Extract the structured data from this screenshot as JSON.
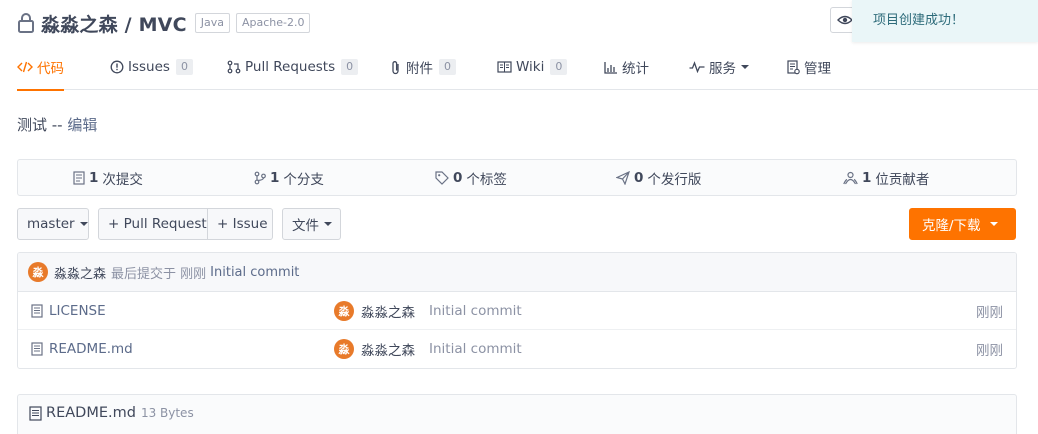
{
  "repo": {
    "title": "淼淼之森 / MVC",
    "tags": [
      "Java",
      "Apache-2.0"
    ]
  },
  "toast": {
    "message": "项目创建成功！"
  },
  "tabs": [
    {
      "label": "代码",
      "icon": "code-icon",
      "active": true
    },
    {
      "label": "Issues",
      "icon": "issue-icon",
      "count": "0"
    },
    {
      "label": "Pull Requests",
      "icon": "pull-request-icon",
      "count": "0"
    },
    {
      "label": "附件",
      "icon": "paperclip-icon",
      "count": "0"
    },
    {
      "label": "Wiki",
      "icon": "wiki-icon",
      "count": "0"
    },
    {
      "label": "统计",
      "icon": "bar-chart-icon"
    },
    {
      "label": "服务",
      "icon": "pulse-icon",
      "dropdown": true
    },
    {
      "label": "管理",
      "icon": "settings-doc-icon"
    }
  ],
  "description": {
    "text": "测试 -- ",
    "edit_link": "编辑"
  },
  "stats": [
    {
      "value": "1",
      "label": "次提交",
      "icon": "commit-icon"
    },
    {
      "value": "1",
      "label": "个分支",
      "icon": "branch-icon"
    },
    {
      "value": "0",
      "label": "个标签",
      "icon": "tag-icon"
    },
    {
      "value": "0",
      "label": "个发行版",
      "icon": "release-icon"
    },
    {
      "value": "1",
      "label": "位贡献者",
      "icon": "contributors-icon"
    }
  ],
  "toolbar": {
    "branch": "master",
    "pull_request": "+ Pull Request",
    "issue": "+ Issue",
    "files": "文件",
    "clone": "克隆/下载"
  },
  "last_commit": {
    "avatar": "淼",
    "author": "淼淼之森",
    "meta": "最后提交于 刚刚",
    "message": "Initial commit"
  },
  "files": [
    {
      "name": "LICENSE",
      "avatar": "淼",
      "author": "淼淼之森",
      "message": "Initial commit",
      "time": "刚刚"
    },
    {
      "name": "README.md",
      "avatar": "淼",
      "author": "淼淼之森",
      "message": "Initial commit",
      "time": "刚刚"
    }
  ],
  "readme": {
    "name": "README.md",
    "size": "13 Bytes"
  },
  "colors": {
    "accent": "#fe7300",
    "avatar": "#e87a2a",
    "toast_bg": "#eaf6f8"
  }
}
